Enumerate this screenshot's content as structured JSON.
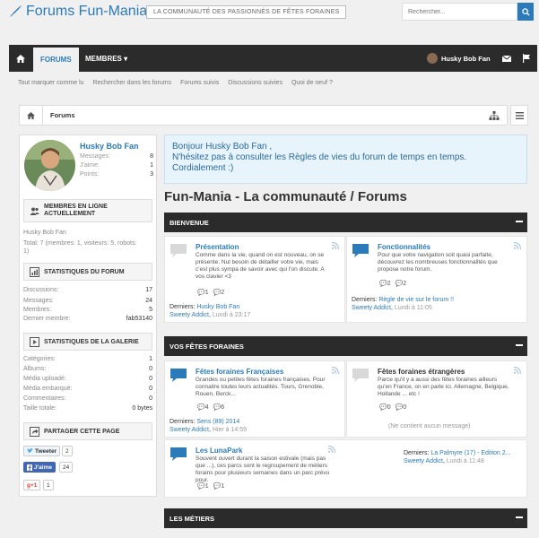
{
  "header": {
    "site_name": "Forums Fun-Mania",
    "tagline": "LA COMMUNAUTÉ DES PASSIONNÉS DE FÊTES FORAINES",
    "search_placeholder": "Rechercher..."
  },
  "nav": {
    "tabs": [
      {
        "label": "FORUMS"
      },
      {
        "label": "MEMBRES ▾"
      }
    ],
    "user_name": "Husky Bob Fan"
  },
  "subnav": {
    "items": [
      "Tout marquer comme lu",
      "Rechercher dans les forums",
      "Forums suivis",
      "Discussions suivies",
      "Quoi de neuf ?"
    ]
  },
  "breadcrumb": {
    "item": "Forums"
  },
  "sidebar": {
    "visitor": {
      "name": "Husky Bob Fan",
      "stats": [
        {
          "label": "Messages:",
          "value": "8"
        },
        {
          "label": "J'aime:",
          "value": "1"
        },
        {
          "label": "Points:",
          "value": "3"
        }
      ]
    },
    "online": {
      "title_line1": "MEMBRES EN LIGNE",
      "title_line2": "ACTUELLEMENT",
      "member": "Husky Bob Fan",
      "total_line1": "Total: 7 (membres: 1, visiteurs: 5, robots:",
      "total_line2": "1)"
    },
    "forum_stats": {
      "title": "STATISTIQUES DU FORUM",
      "rows": [
        {
          "label": "Discussions:",
          "value": "17"
        },
        {
          "label": "Messages:",
          "value": "24"
        },
        {
          "label": "Membres:",
          "value": "5"
        },
        {
          "label": "Dernier membre:",
          "value": "fab53140"
        }
      ]
    },
    "gallery_stats": {
      "title": "STATISTIQUES DE LA GALERIE",
      "rows": [
        {
          "label": "Catégories:",
          "value": "1"
        },
        {
          "label": "Albums:",
          "value": "0"
        },
        {
          "label": "Média uploadé:",
          "value": "0"
        },
        {
          "label": "Média embarqué:",
          "value": "0"
        },
        {
          "label": "Commentaires:",
          "value": "0"
        },
        {
          "label": "Taille totale:",
          "value": "0 bytes"
        }
      ]
    },
    "share": {
      "title": "PARTAGER CETTE PAGE",
      "tweet_label": "Tweeter",
      "tweet_count": "2",
      "like_label": "J'aime",
      "like_count": "24",
      "gplus_label": "g+1",
      "gplus_count": "1"
    }
  },
  "notice": {
    "line1": "Bonjour Husky Bob Fan ,",
    "line2": "N'hésitez pas à consulter les Règles de vies du forum de temps en temps.",
    "line3": "Cordialement :)"
  },
  "page_title": "Fun-Mania - La communauté / Forums",
  "categories": [
    {
      "title": "BIENVENUE",
      "forums": [
        {
          "title": "Présentation",
          "description": "Comme dans la vie, quand on est nouveau, on se présente. Nul besoin de détailler votre vie, mais c'est plus sympa de savoir avec qui l'on discute. A vos clavier <3",
          "discussions": "1",
          "messages": "2",
          "last_label": "Derniers:",
          "last_thread": "Husky Bob Fan",
          "last_user": "Sweety Addict",
          "last_time": "Lundi à 23:17"
        },
        {
          "title": "Fonctionnalités",
          "description": "Pour que votre navigation soit quasi parfaite, découvrez les nombreuses fonctionnalités que propose notre forum.",
          "discussions": "2",
          "messages": "2",
          "last_label": "Derniers:",
          "last_thread": "Règle de vie sur le forum !!",
          "last_user": "Sweety Addict",
          "last_time": "Lundi à 11:05"
        }
      ]
    },
    {
      "title": "VOS FÊTES FORAINES",
      "forums": [
        {
          "title": "Fêtes foraines Françaises",
          "description": "Grandes ou petites fêtes foraines françaises. Pour connaitre toutes leurs actualités. Tours, Grenoble, Rouen, Berck...",
          "discussions": "4",
          "messages": "6",
          "last_label": "Derniers:",
          "last_thread": "Sens (89) 2014",
          "last_user": "Sweety Addict",
          "last_time": "Hier à 14:59"
        },
        {
          "title": "Fêtes foraines étrangères",
          "description": "Parce qu'il y a aussi des fêtes foraines ailleurs qu'en France, on en parle ici. Allemagne, Belgique, Hollande ... etc !",
          "discussions": "0",
          "messages": "0",
          "empty_text": "(Ne contient aucun message)"
        },
        {
          "title": "Les LunaPark",
          "description": "Souvent ouvert durant la saison estivale (mais pas que ...), ces parcs sont le regroupement de métiers forains pour plusieurs semaines dans un parc prévu pour.",
          "discussions": "1",
          "messages": "1",
          "last_label": "Derniers:",
          "last_thread": "La Palmyre (17) - Edition 2...",
          "last_user": "Sweety Addict",
          "last_time": "Lundi à 11:48"
        }
      ]
    },
    {
      "title": "LES MÉTIERS",
      "forums": []
    }
  ],
  "colors": {
    "brand_blue": "#2b7bba",
    "navbar": "#2b2b2b",
    "notice_bg": "#e8f4fc"
  }
}
